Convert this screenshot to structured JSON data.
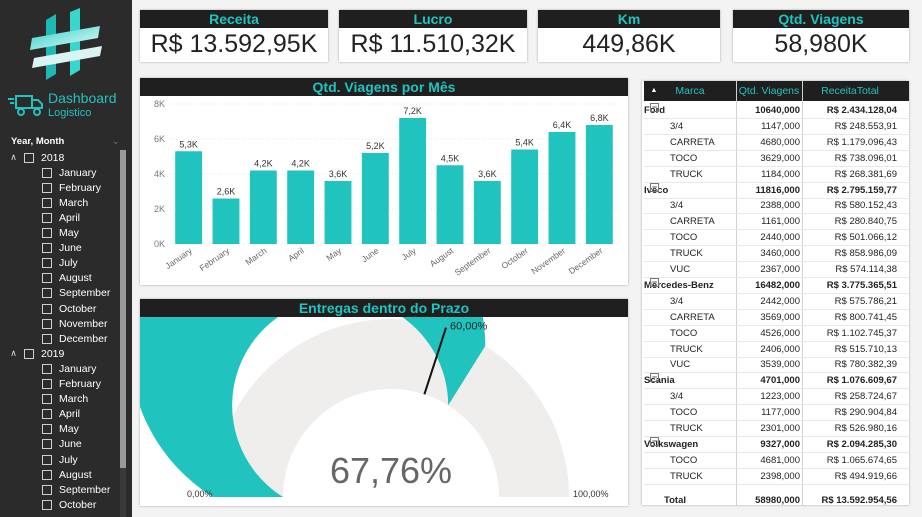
{
  "brand": {
    "title": "Dashboard",
    "subtitle": "Logistico"
  },
  "slicer": {
    "title": "Year, Month",
    "rows": [
      {
        "label": "2018",
        "level": 0
      },
      {
        "label": "January",
        "level": 1
      },
      {
        "label": "February",
        "level": 1
      },
      {
        "label": "March",
        "level": 1
      },
      {
        "label": "April",
        "level": 1
      },
      {
        "label": "May",
        "level": 1
      },
      {
        "label": "June",
        "level": 1
      },
      {
        "label": "July",
        "level": 1
      },
      {
        "label": "August",
        "level": 1
      },
      {
        "label": "September",
        "level": 1
      },
      {
        "label": "October",
        "level": 1
      },
      {
        "label": "November",
        "level": 1
      },
      {
        "label": "December",
        "level": 1
      },
      {
        "label": "2019",
        "level": 0
      },
      {
        "label": "January",
        "level": 1
      },
      {
        "label": "February",
        "level": 1
      },
      {
        "label": "March",
        "level": 1
      },
      {
        "label": "April",
        "level": 1
      },
      {
        "label": "May",
        "level": 1
      },
      {
        "label": "June",
        "level": 1
      },
      {
        "label": "July",
        "level": 1
      },
      {
        "label": "August",
        "level": 1
      },
      {
        "label": "September",
        "level": 1
      },
      {
        "label": "October",
        "level": 1
      }
    ]
  },
  "kpis": [
    {
      "label": "Receita",
      "value": "R$ 13.592,95K"
    },
    {
      "label": "Lucro",
      "value": "R$ 11.510,32K"
    },
    {
      "label": "Km",
      "value": "449,86K"
    },
    {
      "label": "Qtd. Viagens",
      "value": "58,980K"
    }
  ],
  "chart_data": [
    {
      "type": "bar",
      "title": "Qtd. Viagens por Mês",
      "categories": [
        "January",
        "February",
        "March",
        "April",
        "May",
        "June",
        "July",
        "August",
        "September",
        "October",
        "November",
        "December"
      ],
      "values": [
        5300,
        2600,
        4200,
        4200,
        3600,
        5200,
        7200,
        4500,
        3600,
        5400,
        6400,
        6800
      ],
      "data_labels": [
        "5,3K",
        "2,6K",
        "4,2K",
        "4,2K",
        "3,6K",
        "5,2K",
        "7,2K",
        "4,5K",
        "3,6K",
        "5,4K",
        "6,4K",
        "6,8K"
      ],
      "yticks": [
        "0K",
        "2K",
        "4K",
        "6K",
        "8K"
      ],
      "ylim": [
        0,
        8000
      ],
      "color": "#21c3bf"
    }
  ],
  "gauge": {
    "title": "Entregas dentro do Prazo",
    "value": 67.76,
    "value_label": "67,76%",
    "target": 60,
    "target_label": "60,00%",
    "min_label": "0,00%",
    "max_label": "100,00%",
    "color": "#21c3bf",
    "track_color": "#efeeed"
  },
  "table": {
    "headers": [
      "Marca",
      "Qtd. Viagens",
      "ReceitaTotal"
    ],
    "rows": [
      {
        "type": "group",
        "name": "Ford",
        "qty": "10640,000",
        "rev": "R$ 2.434.128,04"
      },
      {
        "type": "item",
        "name": "3/4",
        "qty": "1147,000",
        "rev": "R$ 248.553,91"
      },
      {
        "type": "item",
        "name": "CARRETA",
        "qty": "4680,000",
        "rev": "R$ 1.179.096,43"
      },
      {
        "type": "item",
        "name": "TOCO",
        "qty": "3629,000",
        "rev": "R$ 738.096,01"
      },
      {
        "type": "item",
        "name": "TRUCK",
        "qty": "1184,000",
        "rev": "R$ 268.381,69"
      },
      {
        "type": "group",
        "name": "Iveco",
        "qty": "11816,000",
        "rev": "R$ 2.795.159,77"
      },
      {
        "type": "item",
        "name": "3/4",
        "qty": "2388,000",
        "rev": "R$ 580.152,43"
      },
      {
        "type": "item",
        "name": "CARRETA",
        "qty": "1161,000",
        "rev": "R$ 280.840,75"
      },
      {
        "type": "item",
        "name": "TOCO",
        "qty": "2440,000",
        "rev": "R$ 501.066,12"
      },
      {
        "type": "item",
        "name": "TRUCK",
        "qty": "3460,000",
        "rev": "R$ 858.986,09"
      },
      {
        "type": "item",
        "name": "VUC",
        "qty": "2367,000",
        "rev": "R$ 574.114,38"
      },
      {
        "type": "group",
        "name": "Mercedes-Benz",
        "qty": "16482,000",
        "rev": "R$ 3.775.365,51"
      },
      {
        "type": "item",
        "name": "3/4",
        "qty": "2442,000",
        "rev": "R$ 575.786,21"
      },
      {
        "type": "item",
        "name": "CARRETA",
        "qty": "3569,000",
        "rev": "R$ 800.741,45"
      },
      {
        "type": "item",
        "name": "TOCO",
        "qty": "4526,000",
        "rev": "R$ 1.102.745,37"
      },
      {
        "type": "item",
        "name": "TRUCK",
        "qty": "2406,000",
        "rev": "R$ 515.710,13"
      },
      {
        "type": "item",
        "name": "VUC",
        "qty": "3539,000",
        "rev": "R$ 780.382,39"
      },
      {
        "type": "group",
        "name": "Scania",
        "qty": "4701,000",
        "rev": "R$ 1.076.609,67"
      },
      {
        "type": "item",
        "name": "3/4",
        "qty": "1223,000",
        "rev": "R$ 258.724,67"
      },
      {
        "type": "item",
        "name": "TOCO",
        "qty": "1177,000",
        "rev": "R$ 290.904,84"
      },
      {
        "type": "item",
        "name": "TRUCK",
        "qty": "2301,000",
        "rev": "R$ 526.980,16"
      },
      {
        "type": "group",
        "name": "Volkswagen",
        "qty": "9327,000",
        "rev": "R$ 2.094.285,30"
      },
      {
        "type": "item",
        "name": "TOCO",
        "qty": "4681,000",
        "rev": "R$ 1.065.674,65"
      },
      {
        "type": "item",
        "name": "TRUCK",
        "qty": "2398,000",
        "rev": "R$ 494.919,66"
      },
      {
        "type": "total",
        "name": "Total",
        "qty": "58980,000",
        "rev": "R$ 13.592.954,56"
      }
    ]
  },
  "colors": {
    "accent": "#21c3bf",
    "header_bg": "#1f1f1f",
    "sidebar_bg": "#2b2b2b"
  }
}
